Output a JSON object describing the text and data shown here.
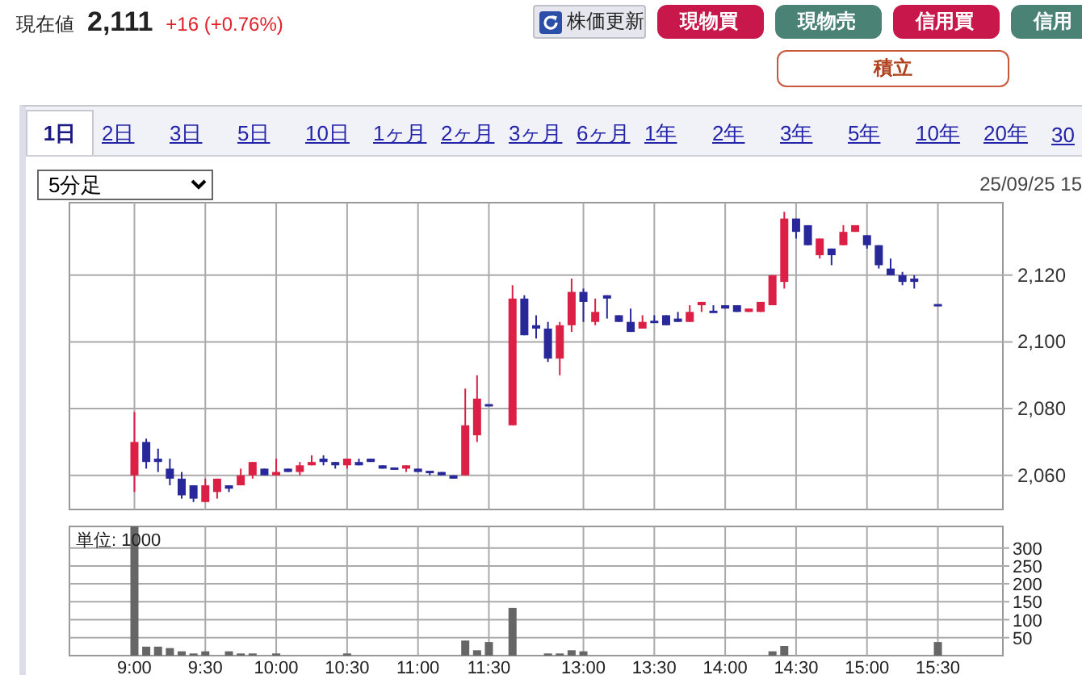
{
  "quote": {
    "label": "現在値",
    "price": "2,111",
    "change": "+16 (+0.76%)"
  },
  "actions": [
    {
      "label": "株価更新",
      "kind": "refresh"
    },
    {
      "label": "現物買",
      "kind": "buy"
    },
    {
      "label": "現物売",
      "kind": "sell"
    },
    {
      "label": "信用買",
      "kind": "buy"
    },
    {
      "label": "信用",
      "kind": "sell"
    }
  ],
  "secondary_action": {
    "label": "積立"
  },
  "period_tabs": [
    {
      "label": "1日",
      "selected": true
    },
    {
      "label": "2日",
      "selected": false
    },
    {
      "label": "3日",
      "selected": false
    },
    {
      "label": "5日",
      "selected": false
    },
    {
      "label": "10日",
      "selected": false
    },
    {
      "label": "1ヶ月",
      "selected": false
    },
    {
      "label": "2ヶ月",
      "selected": false
    },
    {
      "label": "3ヶ月",
      "selected": false
    },
    {
      "label": "6ヶ月",
      "selected": false
    },
    {
      "label": "1年",
      "selected": false
    },
    {
      "label": "2年",
      "selected": false
    },
    {
      "label": "3年",
      "selected": false
    },
    {
      "label": "5年",
      "selected": false
    },
    {
      "label": "10年",
      "selected": false
    },
    {
      "label": "20年",
      "selected": false
    },
    {
      "label": "30",
      "selected": false
    }
  ],
  "interval_select": {
    "value": "5分足"
  },
  "timestamp": "25/09/25 15",
  "price_chart": {
    "chart_data": {
      "type": "candlestick",
      "grid": true,
      "ylim": [
        2050,
        2142
      ],
      "yticks": [
        {
          "value": 2060,
          "label": "2,060"
        },
        {
          "value": 2080,
          "label": "2,080"
        },
        {
          "value": 2100,
          "label": "2,100"
        },
        {
          "value": 2120,
          "label": "2,120"
        }
      ],
      "categories": [
        null,
        null,
        null,
        null,
        null,
        null,
        null,
        null,
        null,
        null,
        null,
        null,
        null,
        null,
        null,
        null,
        null,
        null,
        null,
        null,
        null,
        null,
        null,
        null,
        null,
        null,
        null,
        null,
        null,
        null,
        null,
        null,
        null,
        null,
        null,
        null,
        null,
        null,
        null,
        null,
        null,
        null,
        null,
        null,
        null,
        null,
        null,
        null,
        null,
        null,
        null,
        null,
        null,
        null,
        null,
        null,
        null,
        null,
        null,
        null,
        null,
        null,
        null,
        null,
        null,
        null,
        null,
        null,
        null,
        null,
        null,
        null,
        null,
        null,
        null,
        null,
        null,
        null,
        null
      ],
      "ohlc": [
        null,
        null,
        null,
        null,
        null,
        [
          2060,
          2079,
          2055,
          2070
        ],
        [
          2070,
          2071,
          2062,
          2064
        ],
        [
          2065,
          2068,
          2061,
          2064
        ],
        [
          2062,
          2065,
          2057,
          2059
        ],
        [
          2059,
          2061,
          2053,
          2054
        ],
        [
          2057,
          2057,
          2052,
          2053
        ],
        [
          2052,
          2059,
          2052,
          2057
        ],
        [
          2055,
          2059,
          2053,
          2059
        ],
        [
          2057,
          2057,
          2055,
          2056
        ],
        [
          2057,
          2062,
          2057,
          2060
        ],
        [
          2060,
          2064,
          2059,
          2064
        ],
        [
          2062,
          2062,
          2060,
          2060
        ],
        [
          2060,
          2065,
          2060,
          2061
        ],
        [
          2062,
          2062,
          2061,
          2061
        ],
        [
          2061,
          2064,
          2060,
          2063
        ],
        [
          2063,
          2066,
          2063,
          2064
        ],
        [
          2065,
          2066,
          2063,
          2064
        ],
        [
          2064,
          2064,
          2062,
          2063
        ],
        [
          2063,
          2065,
          2062,
          2065
        ],
        [
          2064,
          2065,
          2063,
          2063
        ],
        [
          2065,
          2065,
          2064,
          2064
        ],
        [
          2063,
          2063,
          2062,
          2062
        ],
        [
          2062,
          2062,
          2062,
          2062
        ],
        [
          2062,
          2063,
          2061,
          2063
        ],
        [
          2062,
          2062,
          2061,
          2061
        ],
        [
          2061,
          2061,
          2060,
          2061
        ],
        [
          2061,
          2061,
          2060,
          2060
        ],
        [
          2060,
          2060,
          2059,
          2059
        ],
        [
          2060,
          2086,
          2060,
          2075
        ],
        [
          2072,
          2090,
          2070,
          2083
        ],
        [
          2081,
          2081,
          2081,
          2081
        ],
        null,
        [
          2075,
          2117,
          2075,
          2113
        ],
        [
          2113,
          2114,
          2102,
          2102
        ],
        [
          2105,
          2108,
          2101,
          2104
        ],
        [
          2104,
          2106,
          2094,
          2095
        ],
        [
          2095,
          2106,
          2090,
          2105
        ],
        [
          2105,
          2119,
          2103,
          2115
        ],
        [
          2115,
          2116,
          2106,
          2112
        ],
        [
          2106,
          2113,
          2105,
          2109
        ],
        [
          2114,
          2114,
          2107,
          2113
        ],
        [
          2108,
          2108,
          2106,
          2106
        ],
        [
          2106,
          2110,
          2103,
          2103
        ],
        [
          2104,
          2108,
          2104,
          2106
        ],
        [
          2106,
          2108,
          2106,
          2106
        ],
        [
          2108,
          2108,
          2105,
          2105
        ],
        [
          2107,
          2109,
          2106,
          2106
        ],
        [
          2106,
          2111,
          2106,
          2109
        ],
        [
          2111,
          2112,
          2109,
          2112
        ],
        [
          2109,
          2111,
          2109,
          2109
        ],
        [
          2111,
          2111,
          2110,
          2110
        ],
        [
          2111,
          2111,
          2109,
          2109
        ],
        [
          2109,
          2110,
          2109,
          2110
        ],
        [
          2109,
          2112,
          2109,
          2112
        ],
        [
          2111,
          2120,
          2111,
          2120
        ],
        [
          2118,
          2139,
          2116,
          2137
        ],
        [
          2137,
          2137,
          2131,
          2133
        ],
        [
          2135,
          2135,
          2129,
          2129
        ],
        [
          2126,
          2131,
          2125,
          2131
        ],
        [
          2128,
          2128,
          2123,
          2126
        ],
        [
          2129,
          2135,
          2129,
          2133
        ],
        [
          2133,
          2135,
          2133,
          2135
        ],
        [
          2132,
          2132,
          2128,
          2129
        ],
        [
          2129,
          2129,
          2122,
          2123
        ],
        [
          2122,
          2125,
          2120,
          2120
        ],
        [
          2120,
          2121,
          2117,
          2118
        ],
        [
          2119,
          2120,
          2116,
          2118
        ],
        null,
        [
          2111,
          2111,
          2111,
          2111
        ],
        null,
        null,
        null,
        null,
        null
      ]
    }
  },
  "volume_chart": {
    "unit_label": "単位: 1000",
    "chart_data": {
      "type": "bar",
      "grid": true,
      "ylim": [
        0,
        360
      ],
      "yticks": [
        50,
        100,
        150,
        200,
        250,
        300
      ],
      "categories": [
        null,
        null,
        null,
        null,
        null,
        "9:00",
        null,
        null,
        null,
        null,
        null,
        "9:30",
        null,
        null,
        null,
        null,
        null,
        "10:00",
        null,
        null,
        null,
        null,
        null,
        "10:30",
        null,
        null,
        null,
        null,
        null,
        "11:00",
        null,
        null,
        null,
        null,
        null,
        "11:30",
        null,
        null,
        null,
        null,
        null,
        null,
        null,
        "13:00",
        null,
        null,
        null,
        null,
        null,
        "13:30",
        null,
        null,
        null,
        null,
        null,
        "14:00",
        null,
        null,
        null,
        null,
        null,
        "14:30",
        null,
        null,
        null,
        null,
        null,
        "15:00",
        null,
        null,
        null,
        null,
        null,
        "15:30",
        null,
        null,
        null,
        null,
        null
      ],
      "series": [
        {
          "color": "#666666",
          "values": [
            null,
            null,
            null,
            null,
            null,
            360,
            25,
            25,
            21,
            12,
            6,
            12,
            0,
            12,
            6,
            6,
            0,
            6,
            0,
            0,
            0,
            0,
            0,
            6,
            0,
            0,
            0,
            0,
            0,
            0,
            0,
            0,
            0,
            42,
            15,
            38,
            null,
            133,
            0,
            0,
            6,
            6,
            15,
            12,
            0,
            0,
            0,
            0,
            0,
            0,
            0,
            0,
            0,
            0,
            0,
            0,
            0,
            0,
            0,
            12,
            27,
            0,
            0,
            0,
            0,
            0,
            0,
            0,
            0,
            0,
            0,
            0,
            null,
            38,
            null,
            null,
            null,
            null,
            null
          ]
        }
      ]
    }
  }
}
